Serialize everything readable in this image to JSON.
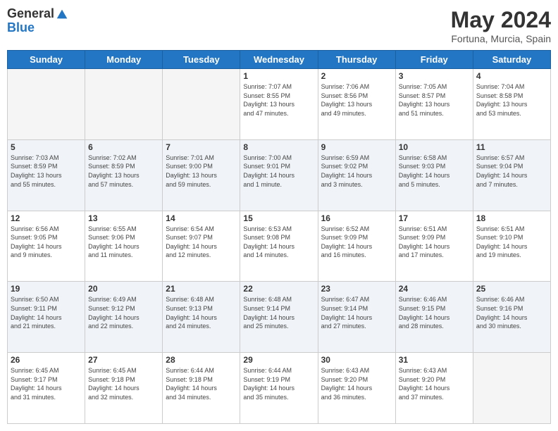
{
  "logo": {
    "general": "General",
    "blue": "Blue"
  },
  "header": {
    "month": "May 2024",
    "location": "Fortuna, Murcia, Spain"
  },
  "weekdays": [
    "Sunday",
    "Monday",
    "Tuesday",
    "Wednesday",
    "Thursday",
    "Friday",
    "Saturday"
  ],
  "rows": [
    [
      {
        "day": "",
        "info": ""
      },
      {
        "day": "",
        "info": ""
      },
      {
        "day": "",
        "info": ""
      },
      {
        "day": "1",
        "info": "Sunrise: 7:07 AM\nSunset: 8:55 PM\nDaylight: 13 hours\nand 47 minutes."
      },
      {
        "day": "2",
        "info": "Sunrise: 7:06 AM\nSunset: 8:56 PM\nDaylight: 13 hours\nand 49 minutes."
      },
      {
        "day": "3",
        "info": "Sunrise: 7:05 AM\nSunset: 8:57 PM\nDaylight: 13 hours\nand 51 minutes."
      },
      {
        "day": "4",
        "info": "Sunrise: 7:04 AM\nSunset: 8:58 PM\nDaylight: 13 hours\nand 53 minutes."
      }
    ],
    [
      {
        "day": "5",
        "info": "Sunrise: 7:03 AM\nSunset: 8:59 PM\nDaylight: 13 hours\nand 55 minutes."
      },
      {
        "day": "6",
        "info": "Sunrise: 7:02 AM\nSunset: 8:59 PM\nDaylight: 13 hours\nand 57 minutes."
      },
      {
        "day": "7",
        "info": "Sunrise: 7:01 AM\nSunset: 9:00 PM\nDaylight: 13 hours\nand 59 minutes."
      },
      {
        "day": "8",
        "info": "Sunrise: 7:00 AM\nSunset: 9:01 PM\nDaylight: 14 hours\nand 1 minute."
      },
      {
        "day": "9",
        "info": "Sunrise: 6:59 AM\nSunset: 9:02 PM\nDaylight: 14 hours\nand 3 minutes."
      },
      {
        "day": "10",
        "info": "Sunrise: 6:58 AM\nSunset: 9:03 PM\nDaylight: 14 hours\nand 5 minutes."
      },
      {
        "day": "11",
        "info": "Sunrise: 6:57 AM\nSunset: 9:04 PM\nDaylight: 14 hours\nand 7 minutes."
      }
    ],
    [
      {
        "day": "12",
        "info": "Sunrise: 6:56 AM\nSunset: 9:05 PM\nDaylight: 14 hours\nand 9 minutes."
      },
      {
        "day": "13",
        "info": "Sunrise: 6:55 AM\nSunset: 9:06 PM\nDaylight: 14 hours\nand 11 minutes."
      },
      {
        "day": "14",
        "info": "Sunrise: 6:54 AM\nSunset: 9:07 PM\nDaylight: 14 hours\nand 12 minutes."
      },
      {
        "day": "15",
        "info": "Sunrise: 6:53 AM\nSunset: 9:08 PM\nDaylight: 14 hours\nand 14 minutes."
      },
      {
        "day": "16",
        "info": "Sunrise: 6:52 AM\nSunset: 9:09 PM\nDaylight: 14 hours\nand 16 minutes."
      },
      {
        "day": "17",
        "info": "Sunrise: 6:51 AM\nSunset: 9:09 PM\nDaylight: 14 hours\nand 17 minutes."
      },
      {
        "day": "18",
        "info": "Sunrise: 6:51 AM\nSunset: 9:10 PM\nDaylight: 14 hours\nand 19 minutes."
      }
    ],
    [
      {
        "day": "19",
        "info": "Sunrise: 6:50 AM\nSunset: 9:11 PM\nDaylight: 14 hours\nand 21 minutes."
      },
      {
        "day": "20",
        "info": "Sunrise: 6:49 AM\nSunset: 9:12 PM\nDaylight: 14 hours\nand 22 minutes."
      },
      {
        "day": "21",
        "info": "Sunrise: 6:48 AM\nSunset: 9:13 PM\nDaylight: 14 hours\nand 24 minutes."
      },
      {
        "day": "22",
        "info": "Sunrise: 6:48 AM\nSunset: 9:14 PM\nDaylight: 14 hours\nand 25 minutes."
      },
      {
        "day": "23",
        "info": "Sunrise: 6:47 AM\nSunset: 9:14 PM\nDaylight: 14 hours\nand 27 minutes."
      },
      {
        "day": "24",
        "info": "Sunrise: 6:46 AM\nSunset: 9:15 PM\nDaylight: 14 hours\nand 28 minutes."
      },
      {
        "day": "25",
        "info": "Sunrise: 6:46 AM\nSunset: 9:16 PM\nDaylight: 14 hours\nand 30 minutes."
      }
    ],
    [
      {
        "day": "26",
        "info": "Sunrise: 6:45 AM\nSunset: 9:17 PM\nDaylight: 14 hours\nand 31 minutes."
      },
      {
        "day": "27",
        "info": "Sunrise: 6:45 AM\nSunset: 9:18 PM\nDaylight: 14 hours\nand 32 minutes."
      },
      {
        "day": "28",
        "info": "Sunrise: 6:44 AM\nSunset: 9:18 PM\nDaylight: 14 hours\nand 34 minutes."
      },
      {
        "day": "29",
        "info": "Sunrise: 6:44 AM\nSunset: 9:19 PM\nDaylight: 14 hours\nand 35 minutes."
      },
      {
        "day": "30",
        "info": "Sunrise: 6:43 AM\nSunset: 9:20 PM\nDaylight: 14 hours\nand 36 minutes."
      },
      {
        "day": "31",
        "info": "Sunrise: 6:43 AM\nSunset: 9:20 PM\nDaylight: 14 hours\nand 37 minutes."
      },
      {
        "day": "",
        "info": ""
      }
    ]
  ]
}
